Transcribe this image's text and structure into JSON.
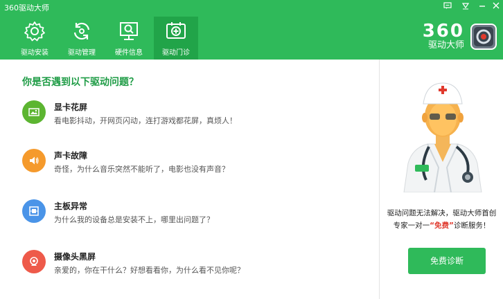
{
  "window": {
    "title": "360驱动大师"
  },
  "controls": [
    {
      "name": "feedback-icon"
    },
    {
      "name": "menu-icon"
    },
    {
      "name": "minimize-icon"
    },
    {
      "name": "close-icon"
    }
  ],
  "tabs": [
    {
      "label": "驱动安装",
      "icon": "gear-icon",
      "active": false
    },
    {
      "label": "驱动管理",
      "icon": "refresh-icon",
      "active": false
    },
    {
      "label": "硬件信息",
      "icon": "monitor-search-icon",
      "active": false
    },
    {
      "label": "驱动门诊",
      "icon": "clinic-icon",
      "active": true
    }
  ],
  "brand": {
    "number": "360",
    "name": "驱动大师"
  },
  "main": {
    "question": "你是否遇到以下驱动问题？",
    "items": [
      {
        "title": "显卡花屏",
        "desc": "看电影抖动，开网页闪动，连打游戏都花屏，真烦人！",
        "color": "#5cb531",
        "icon": "image-icon"
      },
      {
        "title": "声卡故障",
        "desc": "奇怪，为什么音乐突然不能听了，电影也没有声音？",
        "color": "#f59a2c",
        "icon": "speaker-icon"
      },
      {
        "title": "主板异常",
        "desc": "为什么我的设备总是安装不上，哪里出问题了？",
        "color": "#4a94e8",
        "icon": "board-icon"
      },
      {
        "title": "摄像头黑屏",
        "desc": "亲爱的，你在干什么？好想看看你，为什么看不见你呢？",
        "color": "#ee5a4a",
        "icon": "camera-icon"
      }
    ]
  },
  "side": {
    "line1": "驱动问题无法解决，驱动大师首创",
    "line2_prefix": "专家一对一",
    "line2_free": "“免费”",
    "line2_suffix": "诊断服务！",
    "button": "免费诊断"
  }
}
